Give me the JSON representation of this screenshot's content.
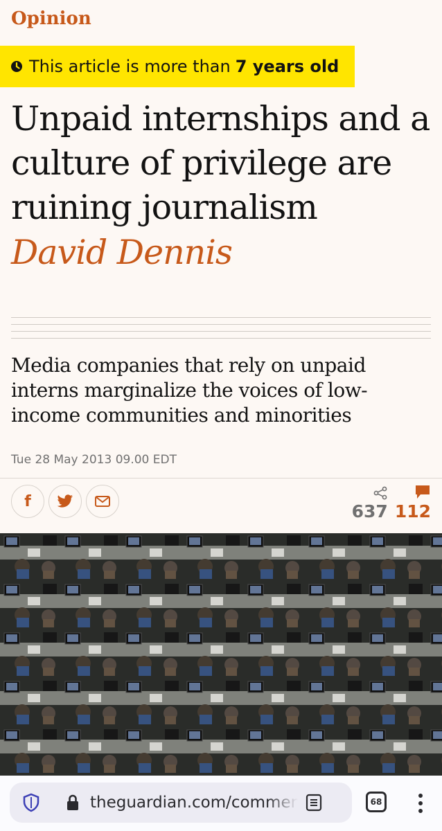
{
  "article": {
    "section": "Opinion",
    "age_notice": {
      "prefix": "This article is more than",
      "emphasis": "7 years old"
    },
    "headline": "Unpaid internships and a culture of privilege are ruining journalism",
    "byline": "David Dennis",
    "standfirst": "Media companies that rely on unpaid interns marginalize the voices of low-income communities and minorities",
    "dateline": "Tue 28 May 2013 09.00 EDT"
  },
  "share": {
    "buttons": [
      {
        "icon": "facebook-icon",
        "glyph": "f"
      },
      {
        "icon": "twitter-icon"
      },
      {
        "icon": "email-icon"
      }
    ],
    "share_count": "637",
    "comment_count": "112"
  },
  "browser": {
    "url": "theguardian.com/commen",
    "tab_count": "68"
  },
  "colors": {
    "accent": "#c7591a",
    "banner": "#ffe500",
    "background": "#fdf8f4"
  }
}
